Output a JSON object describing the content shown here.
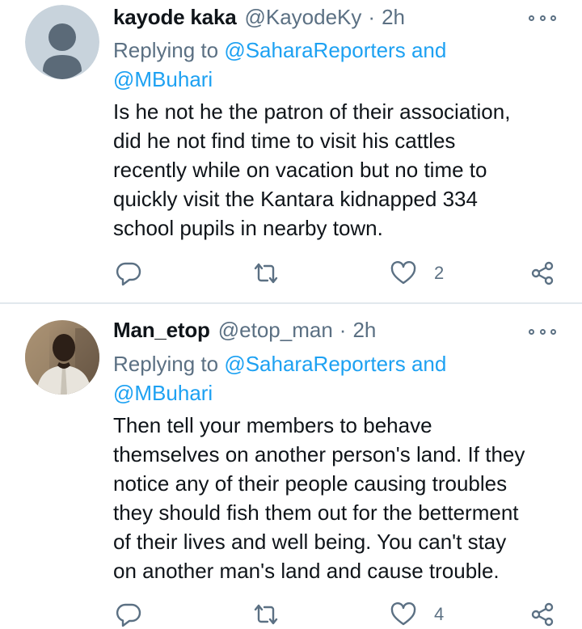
{
  "tweets": [
    {
      "display_name": "kayode kaka",
      "handle": "@KayodeKy",
      "separator": "·",
      "time": "2h",
      "replying_prefix": "Replying to",
      "replying_mention_1": "@SaharaReporters",
      "replying_conjunction": "and",
      "replying_mention_2": "@MBuhari",
      "text": "Is he not he the patron of their association,\ndid he not find time to visit his cattles\nrecently while on vacation but no time to\nquickly visit the Kantara kidnapped 334\nschool pupils in nearby        town.",
      "reply_count": "",
      "retweet_count": "",
      "like_count": "2",
      "avatar": "default-avatar-icon"
    },
    {
      "display_name": "Man_etop",
      "handle": "@etop_man",
      "separator": "·",
      "time": "2h",
      "replying_prefix": "Replying to",
      "replying_mention_1": "@SaharaReporters",
      "replying_conjunction": "and",
      "replying_mention_2": "@MBuhari",
      "text": "Then tell your members to behave\nthemselves on another person's land. If they\nnotice any of their people causing troubles\nthey should fish them out for the betterment\nof their lives and well being. You can't stay\non another man's land and cause trouble.",
      "reply_count": "",
      "retweet_count": "",
      "like_count": "4",
      "avatar": "profile-photo"
    }
  ],
  "icons": {
    "more": "more-icon",
    "reply": "reply-icon",
    "retweet": "retweet-icon",
    "like": "heart-icon",
    "share": "share-icon"
  },
  "colors": {
    "text_primary": "#0f1419",
    "text_secondary": "#5b7083",
    "link": "#1da1f2",
    "divider": "#e1e8ed",
    "default_avatar_bg": "#c8d3dc",
    "default_avatar_fg": "#5b6a78"
  }
}
